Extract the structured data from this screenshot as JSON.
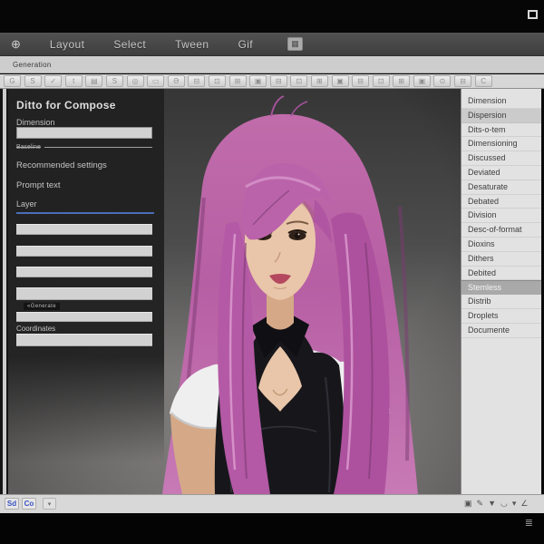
{
  "window": {
    "bottom_right_glyph": "≣"
  },
  "menubar": {
    "app_icon": "⊕",
    "items": [
      {
        "label": "Layout"
      },
      {
        "label": "Select"
      },
      {
        "label": "Tween"
      },
      {
        "label": "Gif"
      }
    ],
    "panel_icon": "▦"
  },
  "tabstrip": {
    "active_tab": "Generation"
  },
  "toolbar": {
    "buttons": [
      "G",
      "S",
      "✓",
      "t",
      "▤",
      "S",
      "◎",
      "▭",
      "Ә",
      "⊟",
      "⊡",
      "⊞",
      "▣",
      "⊟",
      "⊡",
      "⊞",
      "▣",
      "⊟",
      "⊡",
      "⊞",
      "▣",
      "⊙",
      "⊟",
      "C"
    ]
  },
  "left_panel": {
    "title": "Ditto for Compose",
    "dimension_label": "Dimension",
    "divider_label": "Baseline",
    "recommended_label": "Recommended settings",
    "prompt_label": "Prompt text",
    "layer_label": "Layer",
    "generate_label": "«Generate",
    "coordinates_label": "Coordinates"
  },
  "sidebar": {
    "items": [
      {
        "label": "Dimension"
      },
      {
        "label": "Dispersion"
      },
      {
        "label": "Dits-o-tem"
      },
      {
        "label": "Dimensioning"
      },
      {
        "label": "Discussed"
      },
      {
        "label": "Deviated"
      },
      {
        "label": "Desaturate"
      },
      {
        "label": "Debated"
      },
      {
        "label": "Division"
      },
      {
        "label": "Desc-of-format"
      },
      {
        "label": "Dioxins"
      },
      {
        "label": "Dithers"
      },
      {
        "label": "Debited"
      },
      {
        "label": "Stemless"
      },
      {
        "label": "Distrib"
      },
      {
        "label": "Droplets"
      },
      {
        "label": "Documente"
      }
    ]
  },
  "statusbar": {
    "left_icons": [
      "Sd",
      "Co"
    ],
    "dropdown_icon": "▾",
    "right_icons": [
      "▣",
      "✎",
      "▼",
      "◡",
      "▾",
      "∠"
    ]
  },
  "portrait": {
    "description": "portrait of girl with long pink hair, black vest over white t-shirt"
  },
  "colors": {
    "accent-blue": "#4a6db8",
    "status-icon-blue": "#3752c0",
    "hair": "#b75fa4",
    "hair-highlight": "#dc9ed0",
    "hair-shadow": "#7c3a72",
    "skin": "#e9c6a9",
    "skin-shadow": "#d5a988",
    "top-black": "#17171b",
    "sleeve-white": "#efefef",
    "canvas-bg-top": "#363636",
    "canvas-bg-bottom": "#a29f9e"
  }
}
